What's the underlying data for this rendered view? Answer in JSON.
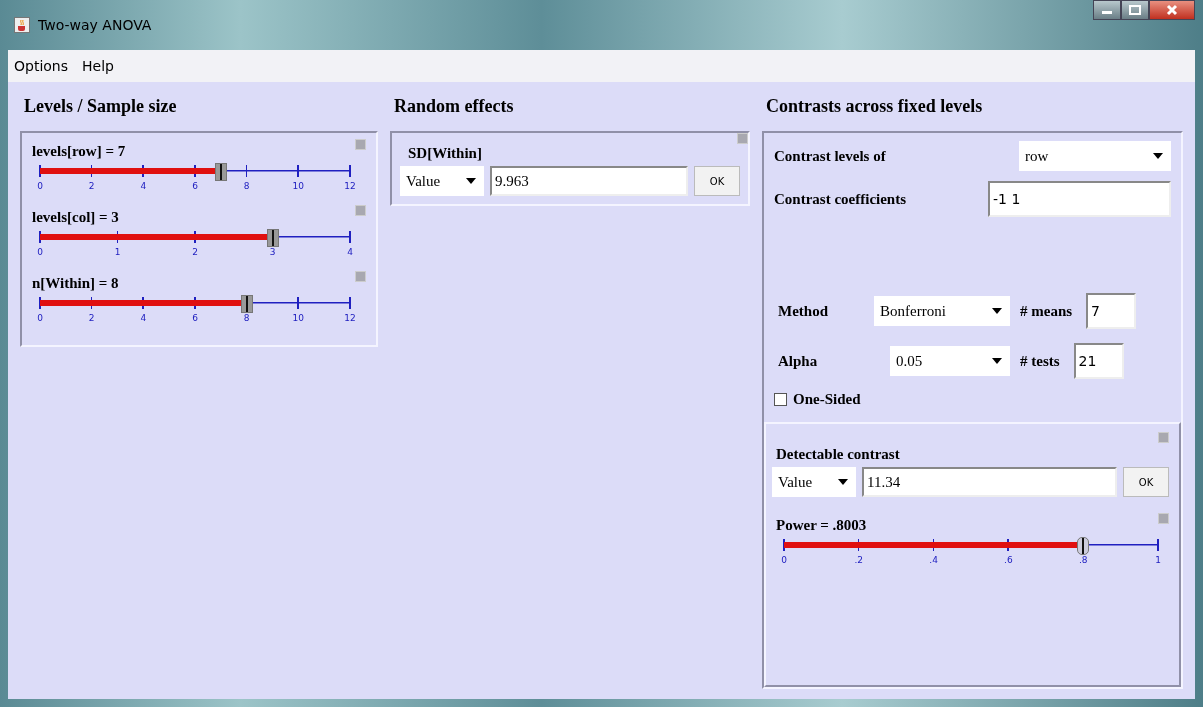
{
  "window": {
    "title": "Two-way ANOVA"
  },
  "menu": [
    {
      "label": "Options"
    },
    {
      "label": "Help"
    }
  ],
  "levels": {
    "heading": "Levels / Sample size",
    "sliders": [
      {
        "label": "levels[row] = 7",
        "ticks": [
          "0",
          "2",
          "4",
          "6",
          "8",
          "10",
          "12"
        ],
        "level": 0.583
      },
      {
        "label": "levels[col] = 3",
        "ticks": [
          "0",
          "1",
          "2",
          "3",
          "4"
        ],
        "level": 0.75
      },
      {
        "label": "n[Within] = 8",
        "ticks": [
          "0",
          "2",
          "4",
          "6",
          "8",
          "10",
          "12"
        ],
        "level": 0.667
      }
    ]
  },
  "random": {
    "heading": "Random effects",
    "sd": {
      "label": "SD[Within]",
      "mode": "Value",
      "value": "9.963",
      "button": "OK"
    }
  },
  "contrasts": {
    "heading": "Contrasts across fixed levels",
    "levels_of": {
      "label": "Contrast levels of",
      "value": "row"
    },
    "coefficients": {
      "label": "Contrast coefficients",
      "value": "-1 1"
    },
    "method": {
      "label": "Method",
      "value": "Bonferroni"
    },
    "means": {
      "label": "# means",
      "value": "7"
    },
    "alpha": {
      "label": "Alpha",
      "value": "0.05"
    },
    "tests": {
      "label": "# tests",
      "value": "21"
    },
    "one_sided": {
      "label": "One-Sided",
      "checked": false
    },
    "detectable": {
      "label": "Detectable contrast",
      "mode": "Value",
      "value": "11.34",
      "button": "OK"
    },
    "power": {
      "label": "Power = .8003",
      "ticks": [
        "0",
        ".2",
        ".4",
        ".6",
        ".8",
        "1"
      ],
      "level": 0.8003
    }
  }
}
